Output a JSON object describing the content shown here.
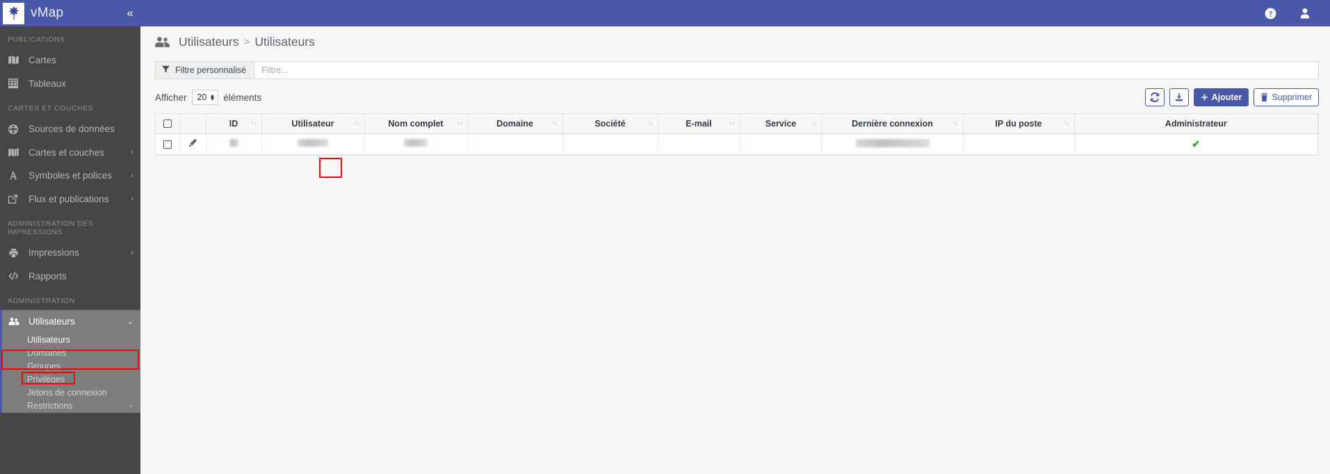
{
  "brand": {
    "name": "vMap",
    "collapse_label": "«",
    "logo_icon": "leaf-logo-icon"
  },
  "topbar": {
    "help_icon": "question-circle-icon",
    "user_icon": "user-account-icon"
  },
  "sidebar": {
    "sections": [
      {
        "label": "PUBLICATIONS",
        "items": [
          {
            "label": "Cartes",
            "icon": "map-icon",
            "chevron": ""
          },
          {
            "label": "Tableaux",
            "icon": "table-grid-icon",
            "chevron": ""
          }
        ]
      },
      {
        "label": "CARTES ET COUCHES",
        "items": [
          {
            "label": "Sources de données",
            "icon": "globe-icon",
            "chevron": ""
          },
          {
            "label": "Cartes et couches",
            "icon": "layers-map-icon",
            "chevron": "›"
          },
          {
            "label": "Symboles et polices",
            "icon": "font-a-icon",
            "chevron": "›"
          },
          {
            "label": "Flux et publications",
            "icon": "external-link-icon",
            "chevron": "›"
          }
        ]
      },
      {
        "label": "ADMINISTRATION DES IMPRESSIONS",
        "items": [
          {
            "label": "Impressions",
            "icon": "printer-icon",
            "chevron": "›"
          },
          {
            "label": "Rapports",
            "icon": "code-brackets-icon",
            "chevron": ""
          }
        ]
      },
      {
        "label": "ADMINISTRATION",
        "items": [
          {
            "label": "Utilisateurs",
            "icon": "users-group-icon",
            "chevron": "⌄",
            "active": true
          }
        ]
      }
    ],
    "subnav": [
      {
        "label": "Utilisateurs",
        "selected": true,
        "chevron": ""
      },
      {
        "label": "Domaines",
        "selected": false,
        "chevron": ""
      },
      {
        "label": "Groupes",
        "selected": false,
        "chevron": ""
      },
      {
        "label": "Privilèges",
        "selected": false,
        "chevron": ""
      },
      {
        "label": "Jetons de connexion",
        "selected": false,
        "chevron": ""
      },
      {
        "label": "Restrictions",
        "selected": false,
        "chevron": "›"
      }
    ]
  },
  "breadcrumb": {
    "icon": "users-group-icon",
    "parent": "Utilisateurs",
    "separator": ">",
    "current": "Utilisateurs"
  },
  "filter": {
    "button_label": "Filtre personnalisé",
    "button_icon": "funnel-icon",
    "input_value": "",
    "input_placeholder": "Filtre..."
  },
  "controls": {
    "show_label": "Afficher",
    "page_length": "20",
    "elements_label": "éléments",
    "buttons": {
      "refresh_icon": "refresh-icon",
      "export_icon": "download-icon",
      "add_label": "Ajouter",
      "add_icon": "plus-icon",
      "delete_label": "Supprimer",
      "delete_icon": "trash-icon"
    }
  },
  "table": {
    "columns": [
      {
        "label": "",
        "key": "select",
        "sortable": false
      },
      {
        "label": "",
        "key": "actions",
        "sortable": false
      },
      {
        "label": "ID",
        "key": "id",
        "sortable": true
      },
      {
        "label": "Utilisateur",
        "key": "user",
        "sortable": true
      },
      {
        "label": "Nom complet",
        "key": "fullname",
        "sortable": true
      },
      {
        "label": "Domaine",
        "key": "domain",
        "sortable": true
      },
      {
        "label": "Société",
        "key": "company",
        "sortable": true
      },
      {
        "label": "E-mail",
        "key": "email",
        "sortable": true
      },
      {
        "label": "Service",
        "key": "service",
        "sortable": true
      },
      {
        "label": "Dernière connexion",
        "key": "lastlogin",
        "sortable": true
      },
      {
        "label": "IP du poste",
        "key": "ip",
        "sortable": true
      },
      {
        "label": "Administrateur",
        "key": "admin",
        "sortable": false
      }
    ],
    "sort_icon": "sort-updown-icon",
    "rows": [
      {
        "selected": false,
        "edit_icon": "pencil-edit-icon",
        "id": "",
        "user": "",
        "fullname": "",
        "domain": "",
        "company": "",
        "email": "",
        "service": "",
        "lastlogin": "",
        "ip": "",
        "admin": "✔",
        "redacted": true
      }
    ]
  },
  "annotations": [
    {
      "name": "highlight-sidebar-utilisateurs",
      "color": "#ff0000"
    },
    {
      "name": "highlight-sidebar-utilisateurs-sub",
      "color": "#ff0000"
    },
    {
      "name": "highlight-row-edit-button",
      "color": "#ff0000"
    }
  ],
  "colors": {
    "brand_blue": "#4a58a8",
    "sidebar_bg": "#454545",
    "sidebar_active": "#7d7d7d",
    "annotation_red": "#ff0000",
    "check_green": "#2ba12b"
  }
}
